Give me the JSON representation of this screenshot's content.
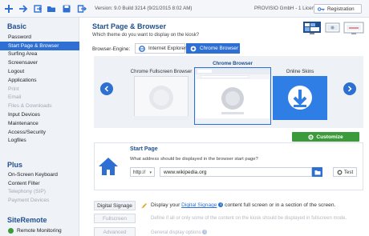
{
  "topbar": {
    "version": "Version: 9.0 Build 3214 (9/21/2015 8:02 AM)",
    "license": "PROVISIO GmbH - 1 License(s)",
    "registration": "Registration",
    "icons": [
      "add-icon",
      "forward-icon",
      "open-icon",
      "folder-icon",
      "save-icon",
      "export-icon"
    ]
  },
  "sidebar": {
    "basic_title": "Basic",
    "basic_items": [
      {
        "label": "Password",
        "state": "normal"
      },
      {
        "label": "Start Page & Browser",
        "state": "selected"
      },
      {
        "label": "Surfing Area",
        "state": "normal"
      },
      {
        "label": "Screensaver",
        "state": "normal"
      },
      {
        "label": "Logout",
        "state": "normal"
      },
      {
        "label": "Applications",
        "state": "normal"
      },
      {
        "label": "Print",
        "state": "disabled"
      },
      {
        "label": "Email",
        "state": "disabled"
      },
      {
        "label": "Files & Downloads",
        "state": "disabled"
      },
      {
        "label": "Input Devices",
        "state": "normal"
      },
      {
        "label": "Maintenance",
        "state": "normal"
      },
      {
        "label": "Access/Security",
        "state": "normal"
      },
      {
        "label": "Logfiles",
        "state": "normal"
      }
    ],
    "plus_title": "Plus",
    "plus_items": [
      {
        "label": "On-Screen Keyboard",
        "state": "normal"
      },
      {
        "label": "Content Filter",
        "state": "normal"
      },
      {
        "label": "Telephony (SIP)",
        "state": "disabled"
      },
      {
        "label": "Payment Devices",
        "state": "disabled"
      }
    ],
    "siteremote_title": "SiteRemote",
    "siteremote_items": [
      {
        "label": "Remote Monitoring",
        "state": "normal"
      }
    ]
  },
  "main": {
    "title": "Start Page & Browser",
    "subtitle": "Which theme do you want to display on the kiosk?",
    "engine_label": "Browser-Engine:",
    "engine_ie": "Internet Explorer",
    "engine_chrome": "Chrome Browser",
    "options": {
      "left": "Chrome Fullscreen Browser",
      "center": "Chrome Browser",
      "right": "Online Skins"
    },
    "customize": "Customize",
    "start_page": {
      "title": "Start Page",
      "description": "What address should be displayed in the browser start page?",
      "protocol": "http://",
      "url": "www.wikipedia.org",
      "test": "Test"
    },
    "features": [
      {
        "button": "Digital Signage",
        "state": "normal",
        "pre": "Display your ",
        "link": "Digital Signage",
        "post": " content full screen or in a section of the screen."
      },
      {
        "button": "Fullscreen",
        "state": "disabled",
        "text": "Define if all or only some of the content on the kiosk should be displayed in fullscreen mode."
      },
      {
        "button": "Advanced",
        "state": "disabled",
        "text": "General display options"
      }
    ]
  },
  "colors": {
    "accent": "#2e6fd3",
    "title": "#1f4f8f",
    "customize": "#3b9a3a"
  }
}
